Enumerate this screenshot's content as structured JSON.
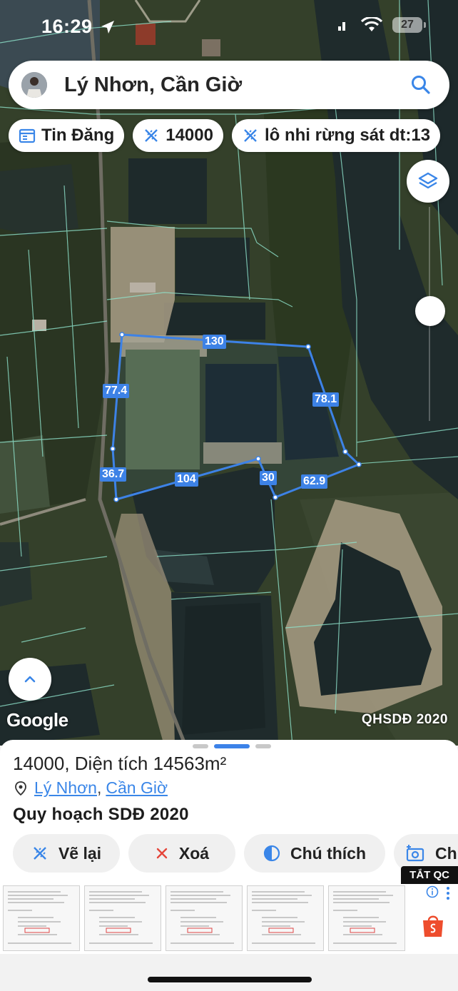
{
  "status_bar": {
    "time": "16:29",
    "battery": "27"
  },
  "search": {
    "query": "Lý Nhơn, Cần Giờ"
  },
  "chips": [
    {
      "icon": "calendar-icon",
      "label": "Tin Đăng"
    },
    {
      "icon": "ruler-icon",
      "label": "14000"
    },
    {
      "icon": "ruler-icon",
      "label": "lô nhi rừng sát dt:13"
    }
  ],
  "map": {
    "google_label": "Google",
    "layer_badge": "QHSDĐ 2020",
    "edge_labels": [
      "130",
      "77.4",
      "78.1",
      "36.7",
      "104",
      "30",
      "62.9"
    ],
    "accent_color": "#3d82e6"
  },
  "sheet": {
    "title_name": "14000",
    "title_area_label": ", Diện tích",
    "title_area_value": "14563m²",
    "location_commune": "Lý Nhơn",
    "location_separator": ",",
    "location_district": "Cần Giờ",
    "plan_title": "Quy hoạch SDĐ 2020",
    "actions": [
      {
        "icon": "ruler-icon",
        "label": "Vẽ lại"
      },
      {
        "icon": "close-icon",
        "label": "Xoá"
      },
      {
        "icon": "contrast-icon",
        "label": "Chú thích"
      },
      {
        "icon": "camera-icon",
        "label": "Ch"
      }
    ]
  },
  "ad": {
    "badge": "TẮT QC"
  }
}
